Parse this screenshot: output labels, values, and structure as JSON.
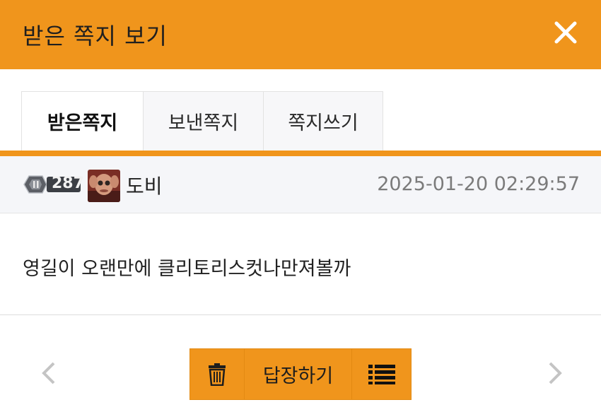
{
  "header": {
    "title": "받은 쪽지 보기",
    "close_icon": "close-icon"
  },
  "tabs": [
    {
      "label": "받은쪽지",
      "active": true
    },
    {
      "label": "보낸쪽지",
      "active": false
    },
    {
      "label": "쪽지쓰기",
      "active": false
    }
  ],
  "message": {
    "level": "287",
    "sender": "도비",
    "date": "2025-01-20 02:29:57",
    "body": "영길이 오랜만에 클리토리스컷나만져볼까"
  },
  "actions": {
    "delete_icon": "trash-icon",
    "reply_label": "답장하기",
    "list_icon": "list-icon"
  },
  "colors": {
    "accent": "#f0951c",
    "head_bg": "#f5f6f9"
  }
}
